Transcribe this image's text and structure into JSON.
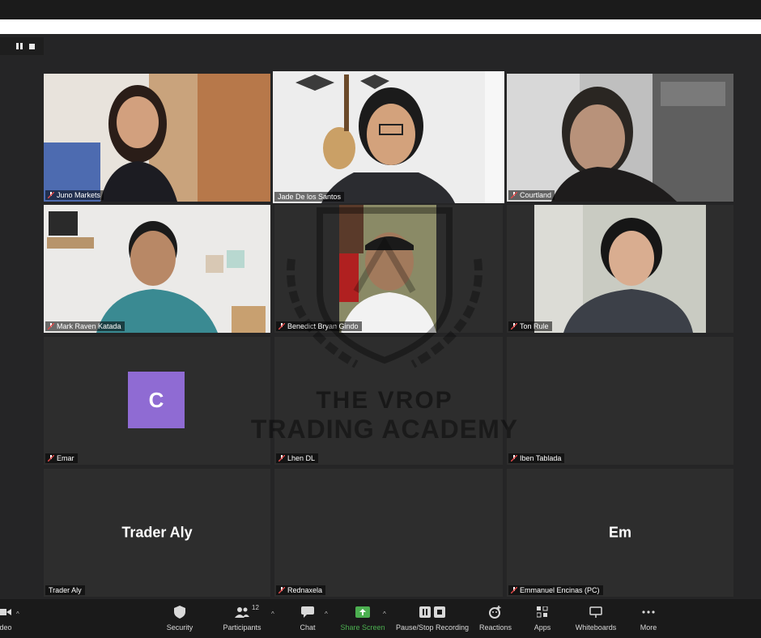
{
  "watermark": {
    "line1": "THE VROP",
    "line2": "TRADING ACADEMY"
  },
  "participants": [
    {
      "name": "Juno Markets",
      "muted": true,
      "type": "video"
    },
    {
      "name": "Jade De los Santos",
      "muted": false,
      "type": "video",
      "active_speaker": true
    },
    {
      "name": "Courtland",
      "muted": true,
      "type": "video"
    },
    {
      "name": "Mark Raven Katada",
      "muted": true,
      "type": "video"
    },
    {
      "name": "Benedict Bryan Gindo",
      "muted": true,
      "type": "video"
    },
    {
      "name": "Ton Rule",
      "muted": true,
      "type": "video"
    },
    {
      "name": "Emar",
      "muted": true,
      "type": "avatar",
      "avatar_letter": "C",
      "avatar_color": "#8f6bd3"
    },
    {
      "name": "Lhen DL",
      "muted": true,
      "type": "blank"
    },
    {
      "name": "Iben Tablada",
      "muted": true,
      "type": "blank"
    },
    {
      "name": "Trader Aly",
      "muted": false,
      "type": "name",
      "display": "Trader Aly"
    },
    {
      "name": "Rednaxela",
      "muted": true,
      "type": "blank"
    },
    {
      "name": "Emmanuel Encinas (PC)",
      "muted": true,
      "type": "name",
      "display": "Em"
    }
  ],
  "toolbar": {
    "video_label": "ideo",
    "security": "Security",
    "participants": "Participants",
    "participants_count": "12",
    "chat": "Chat",
    "share_screen": "Share Screen",
    "recording": "Pause/Stop Recording",
    "reactions": "Reactions",
    "apps": "Apps",
    "whiteboards": "Whiteboards",
    "more": "More"
  },
  "colors": {
    "active_speaker_border": "#d9ef86",
    "share_green": "#4caf50",
    "muted_red": "#e04848"
  }
}
